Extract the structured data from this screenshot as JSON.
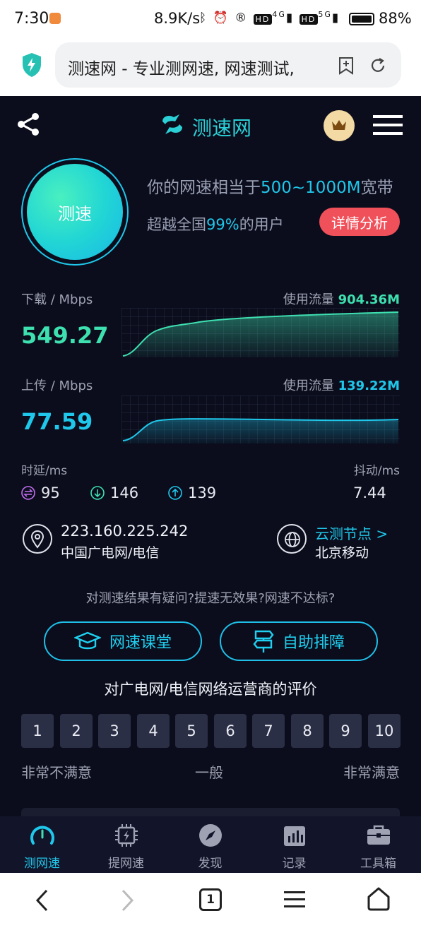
{
  "status_bar": {
    "time": "7:30",
    "net_speed": "8.9K/s",
    "battery": "88%",
    "signal_labels": [
      "HD",
      "4G",
      "HD",
      "5G"
    ]
  },
  "browser": {
    "url_title": "测速网 - 专业测网速, 网速测试,",
    "shield_icon": "shield-bolt-icon"
  },
  "header": {
    "logo_text": "测速网"
  },
  "speed_summary": {
    "test_button": "测速",
    "equiv_prefix": "你的网速相当于",
    "equiv_value": "500~1000M",
    "equiv_suffix": "宽带",
    "beat_prefix": "超越全国",
    "beat_value": "99%",
    "beat_suffix": "的用户",
    "detail_button": "详情分析"
  },
  "download": {
    "label": "下载 / Mbps",
    "value": "549.27",
    "traffic_label": "使用流量",
    "traffic_value": "904.36M",
    "color": "#3ee0b0"
  },
  "upload": {
    "label": "上传 / Mbps",
    "value": "77.59",
    "traffic_label": "使用流量",
    "traffic_value": "139.22M",
    "color": "#1fc7ea"
  },
  "latency": {
    "label": "时延/ms",
    "jitter_label": "抖动/ms",
    "ping": "95",
    "down_ping": "146",
    "up_ping": "139",
    "jitter": "7.44"
  },
  "network": {
    "ip": "223.160.225.242",
    "isp": "中国广电网/电信",
    "node_label": "云测节点 >",
    "node_value": "北京移动"
  },
  "help": {
    "question": "对测速结果有疑问?提速无效果?网速不达标?",
    "course_button": "网速课堂",
    "troubleshoot_button": "自助排障"
  },
  "rating": {
    "title": "对广电网/电信网络运营商的评价",
    "scores": [
      "1",
      "2",
      "3",
      "4",
      "5",
      "6",
      "7",
      "8",
      "9",
      "10"
    ],
    "low_label": "非常不满意",
    "mid_label": "一般",
    "high_label": "非常满意"
  },
  "tabs": [
    {
      "label": "测网速",
      "icon": "speedometer-icon",
      "active": true
    },
    {
      "label": "提网速",
      "icon": "chip-bolt-icon",
      "active": false
    },
    {
      "label": "发现",
      "icon": "compass-icon",
      "active": false
    },
    {
      "label": "记录",
      "icon": "bar-chart-icon",
      "active": false
    },
    {
      "label": "工具箱",
      "icon": "toolbox-icon",
      "active": false
    }
  ],
  "nav": {
    "tab_count": "1"
  },
  "colors": {
    "accent_cyan": "#1fc7ea",
    "accent_green": "#3ee0b0",
    "detail_red": "#f0505a",
    "background": "#0b0d1c"
  }
}
